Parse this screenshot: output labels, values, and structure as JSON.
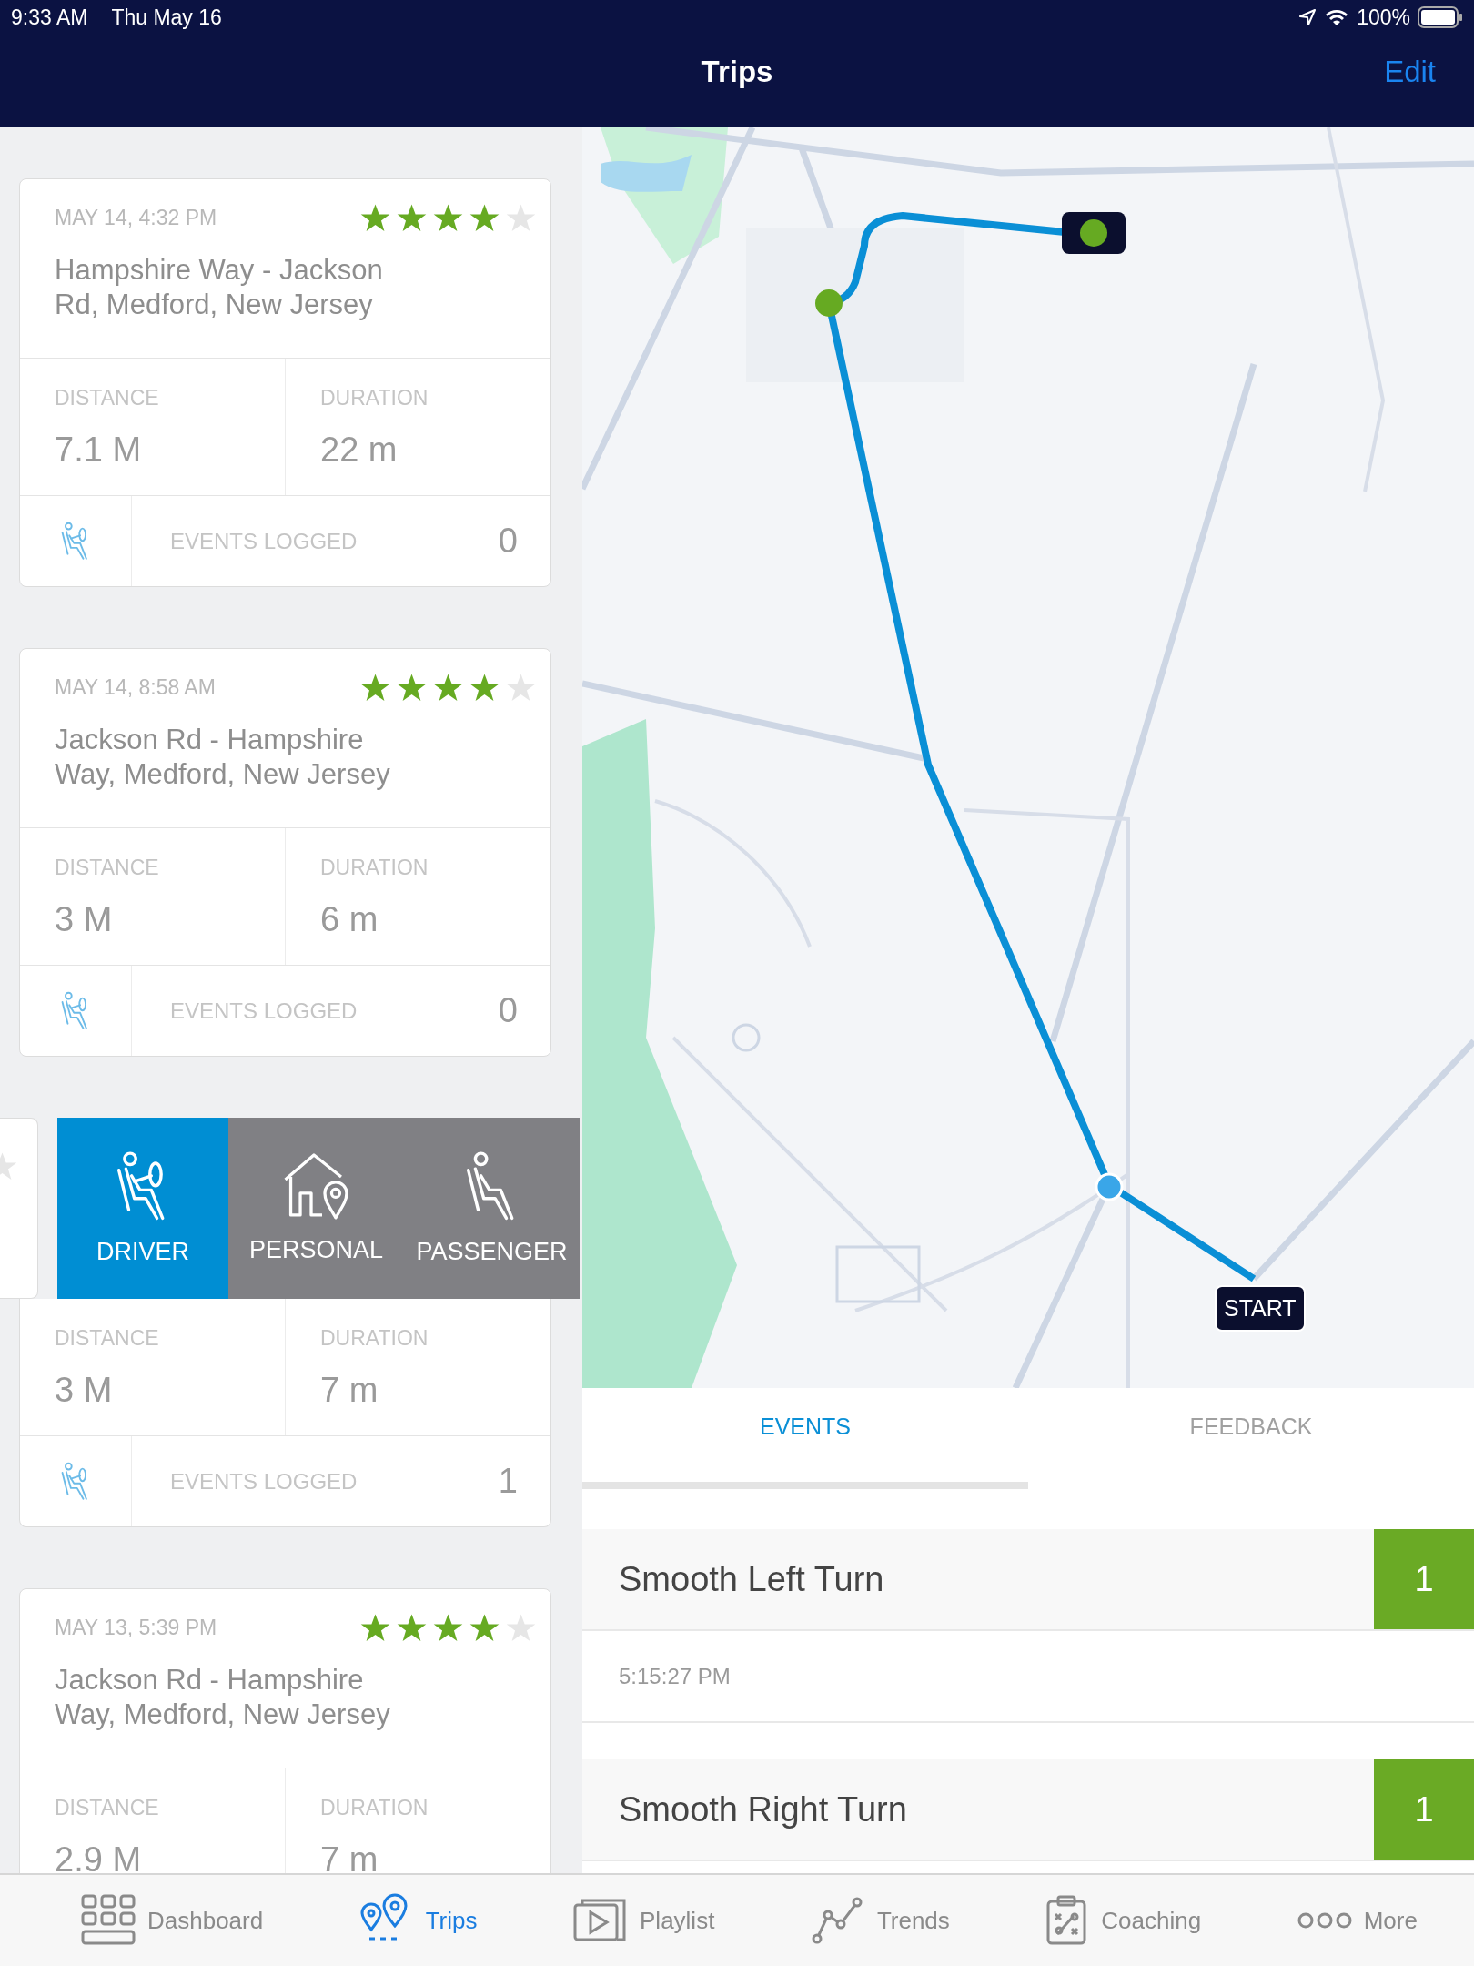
{
  "status_bar": {
    "time": "9:33 AM",
    "date": "Thu May 16",
    "battery": "100%"
  },
  "nav_bar": {
    "title": "Trips",
    "action": "Edit"
  },
  "trips": [
    {
      "swiped": false,
      "date": "MAY 14, 4:32 PM",
      "stars": 4,
      "route": "Hampshire Way - Jackson Rd, Medford, New Jersey",
      "distance_label": "DISTANCE",
      "distance": "7.1 M",
      "duration_label": "DURATION",
      "duration": "22 m",
      "events_label": "EVENTS LOGGED",
      "events_logged": "0"
    },
    {
      "swiped": false,
      "date": "MAY 14, 8:58 AM",
      "stars": 4,
      "route": "Jackson Rd - Hampshire Way, Medford, New Jersey",
      "distance_label": "DISTANCE",
      "distance": "3 M",
      "duration_label": "DURATION",
      "duration": "6 m",
      "events_label": "EVENTS LOGGED",
      "events_logged": "0"
    },
    {
      "swiped": true,
      "actions": [
        {
          "label": "DRIVER",
          "selected": true
        },
        {
          "label": "PERSONAL",
          "selected": false
        },
        {
          "label": "PASSENGER",
          "selected": false
        }
      ],
      "distance_label": "DISTANCE",
      "distance": "3 M",
      "duration_label": "DURATION",
      "duration": "7 m",
      "events_label": "EVENTS LOGGED",
      "events_logged": "1"
    },
    {
      "swiped": false,
      "date": "MAY 13, 5:39 PM",
      "stars": 4,
      "route": "Jackson Rd - Hampshire Way, Medford, New Jersey",
      "distance_label": "DISTANCE",
      "distance": "2.9 M",
      "duration_label": "DURATION",
      "duration": "7 m"
    }
  ],
  "map": {
    "start_label": "START"
  },
  "events_panel": {
    "tabs": [
      {
        "label": "EVENTS",
        "selected": true
      },
      {
        "label": "FEEDBACK",
        "selected": false
      }
    ],
    "events": [
      {
        "name": "Smooth Left Turn",
        "count": "1",
        "time": "5:15:27 PM"
      },
      {
        "name": "Smooth Right Turn",
        "count": "1"
      }
    ]
  },
  "tab_bar": [
    {
      "label": "Dashboard",
      "selected": false
    },
    {
      "label": "Trips",
      "selected": true
    },
    {
      "label": "Playlist",
      "selected": false
    },
    {
      "label": "Trends",
      "selected": false
    },
    {
      "label": "Coaching",
      "selected": false
    },
    {
      "label": "More",
      "selected": false
    }
  ]
}
